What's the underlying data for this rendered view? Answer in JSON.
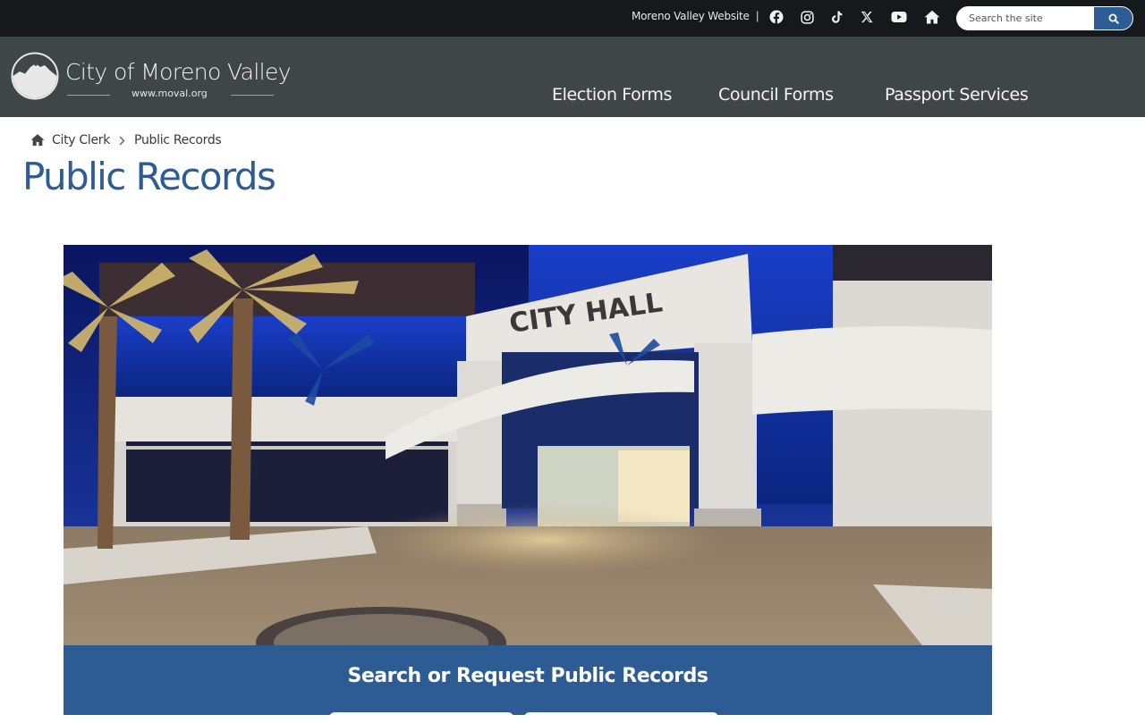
{
  "topbar": {
    "website_link": "Moreno Valley Website",
    "separator": "|",
    "social_icons": [
      "facebook-icon",
      "instagram-icon",
      "tiktok-icon",
      "x-icon",
      "youtube-icon",
      "home-icon"
    ],
    "search": {
      "placeholder": "Search the site",
      "button_icon": "search-icon"
    }
  },
  "header": {
    "brand": "City of Moreno Valley",
    "url": "www.moval.org",
    "nav": [
      {
        "label": "Election Forms"
      },
      {
        "label": "Council Forms"
      },
      {
        "label": "Passport Services"
      }
    ]
  },
  "breadcrumb": {
    "home_icon": "home-icon",
    "items": [
      "City Clerk",
      "Public Records"
    ]
  },
  "page": {
    "title": "Public Records"
  },
  "hero": {
    "sign_text": "CITY HALL",
    "seal_text": "CITY OF MORENO VALLEY"
  },
  "banner": {
    "title": "Search or Request Public Records"
  },
  "colors": {
    "topbar_bg": "#16191b",
    "header_bg": "#3e4647",
    "accent_blue": "#2d5b94",
    "title_blue": "#2d5b94"
  }
}
